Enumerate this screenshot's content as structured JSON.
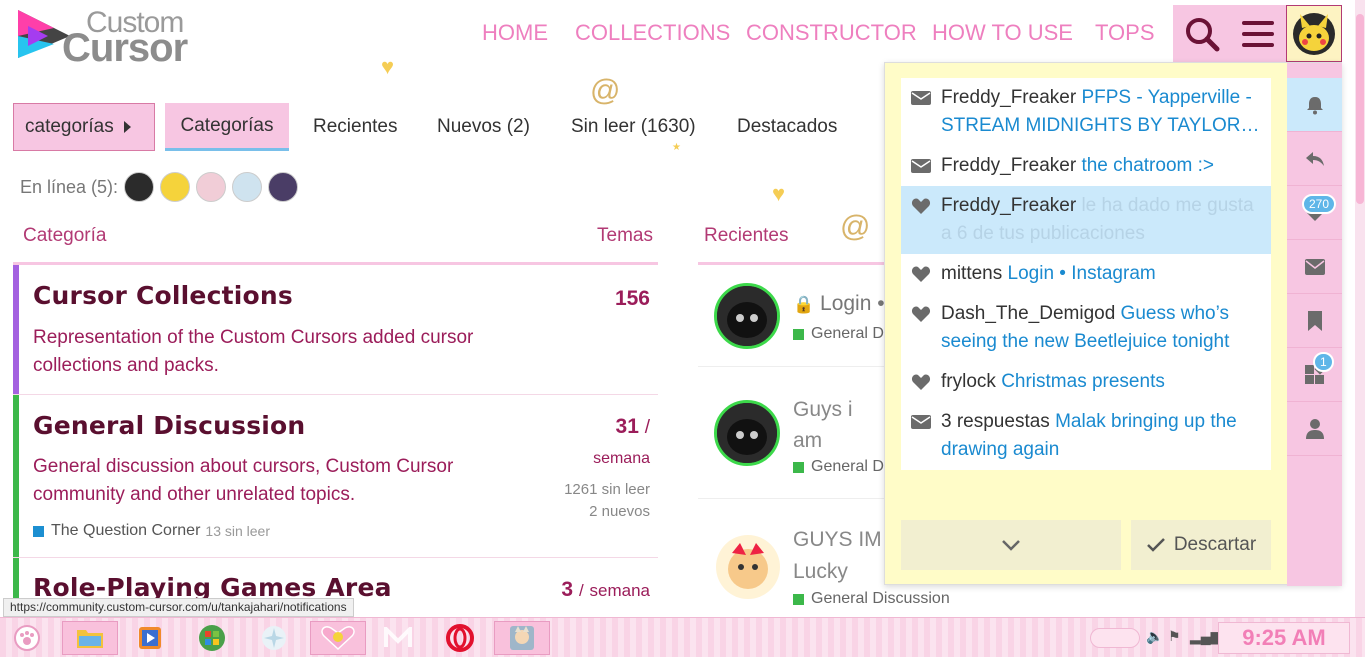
{
  "logo": {
    "line1": "Custom",
    "line2": "Cursor"
  },
  "nav": [
    {
      "label": "HOME"
    },
    {
      "label": "COLLECTIONS"
    },
    {
      "label": "CONSTRUCTOR"
    },
    {
      "label": "HOW TO USE"
    },
    {
      "label": "TOPS"
    }
  ],
  "header": {
    "search_icon": "search-icon",
    "menu_icon": "hamburger-menu-icon"
  },
  "tabs": {
    "dropdown_label": "categorías",
    "items": [
      "Categorías",
      "Recientes",
      "Nuevos (2)",
      "Sin leer (1630)",
      "Destacados"
    ]
  },
  "online": {
    "label": "En línea (5):",
    "users": [
      "#2b2b2b",
      "#f5d33b",
      "#f1cdd7",
      "#cfe3ef",
      "#4a3d66"
    ]
  },
  "table": {
    "col_category": "Categoría",
    "col_topics": "Temas",
    "col_recent": "Recientes"
  },
  "categories": [
    {
      "title": "Cursor Collections",
      "desc": "Representation of the Custom Cursors added cursor collections and packs.",
      "count": "156",
      "color": "#a461e0"
    },
    {
      "title": "General Discussion",
      "desc": "General discussion about cursors, Custom Cursor community and other unrelated topics.",
      "count": "31",
      "period_sep": "/",
      "period": "semana",
      "unread": "1261 sin leer",
      "new": "2 nuevos",
      "color": "#3cb84a",
      "subcategory": {
        "name": "The Question Corner",
        "unread": "13 sin leer"
      }
    },
    {
      "title": "Role-Playing Games Area",
      "count": "3",
      "period_sep": "/",
      "period": "semana",
      "color": "#3cb84a"
    }
  ],
  "recent": [
    {
      "title": "Login •",
      "category": "General D"
    },
    {
      "title": "Guys i am something",
      "category": "General D"
    },
    {
      "title": "GUYS IM Lucky",
      "category": "General Discussion"
    }
  ],
  "notifications": [
    {
      "type": "message",
      "user": "Freddy_Freaker",
      "text": "PFPS - Yapperville - STREAM MIDNIGHTS BY TAYLOR…"
    },
    {
      "type": "message",
      "user": "Freddy_Freaker",
      "text": "the chatroom :>"
    },
    {
      "type": "like",
      "user": "Freddy_Freaker",
      "text": "le ha dado me gusta a 6 de tus publicaciones",
      "highlighted": true
    },
    {
      "type": "like",
      "user": "mittens",
      "text": "Login • Instagram"
    },
    {
      "type": "like",
      "user": "Dash_The_Demigod",
      "text": "Guess who’s seeing the new Beetlejuice tonight"
    },
    {
      "type": "like",
      "user": "frylock",
      "text": "Christmas presents"
    },
    {
      "type": "message",
      "user": "3 respuestas",
      "text": "Malak bringing up the drawing again"
    }
  ],
  "panel": {
    "dismiss_label": "Descartar",
    "side_buttons": [
      {
        "icon": "bell-icon"
      },
      {
        "icon": "reply-icon"
      },
      {
        "icon": "heart-icon",
        "badge": "270"
      },
      {
        "icon": "envelope-icon"
      },
      {
        "icon": "bookmark-icon"
      },
      {
        "icon": "grid-icon",
        "badge": "1"
      },
      {
        "icon": "user-icon"
      }
    ]
  },
  "status_url": "https://community.custom-cursor.com/u/tankajahari/notifications",
  "taskbar": {
    "time": "9:25 AM"
  }
}
